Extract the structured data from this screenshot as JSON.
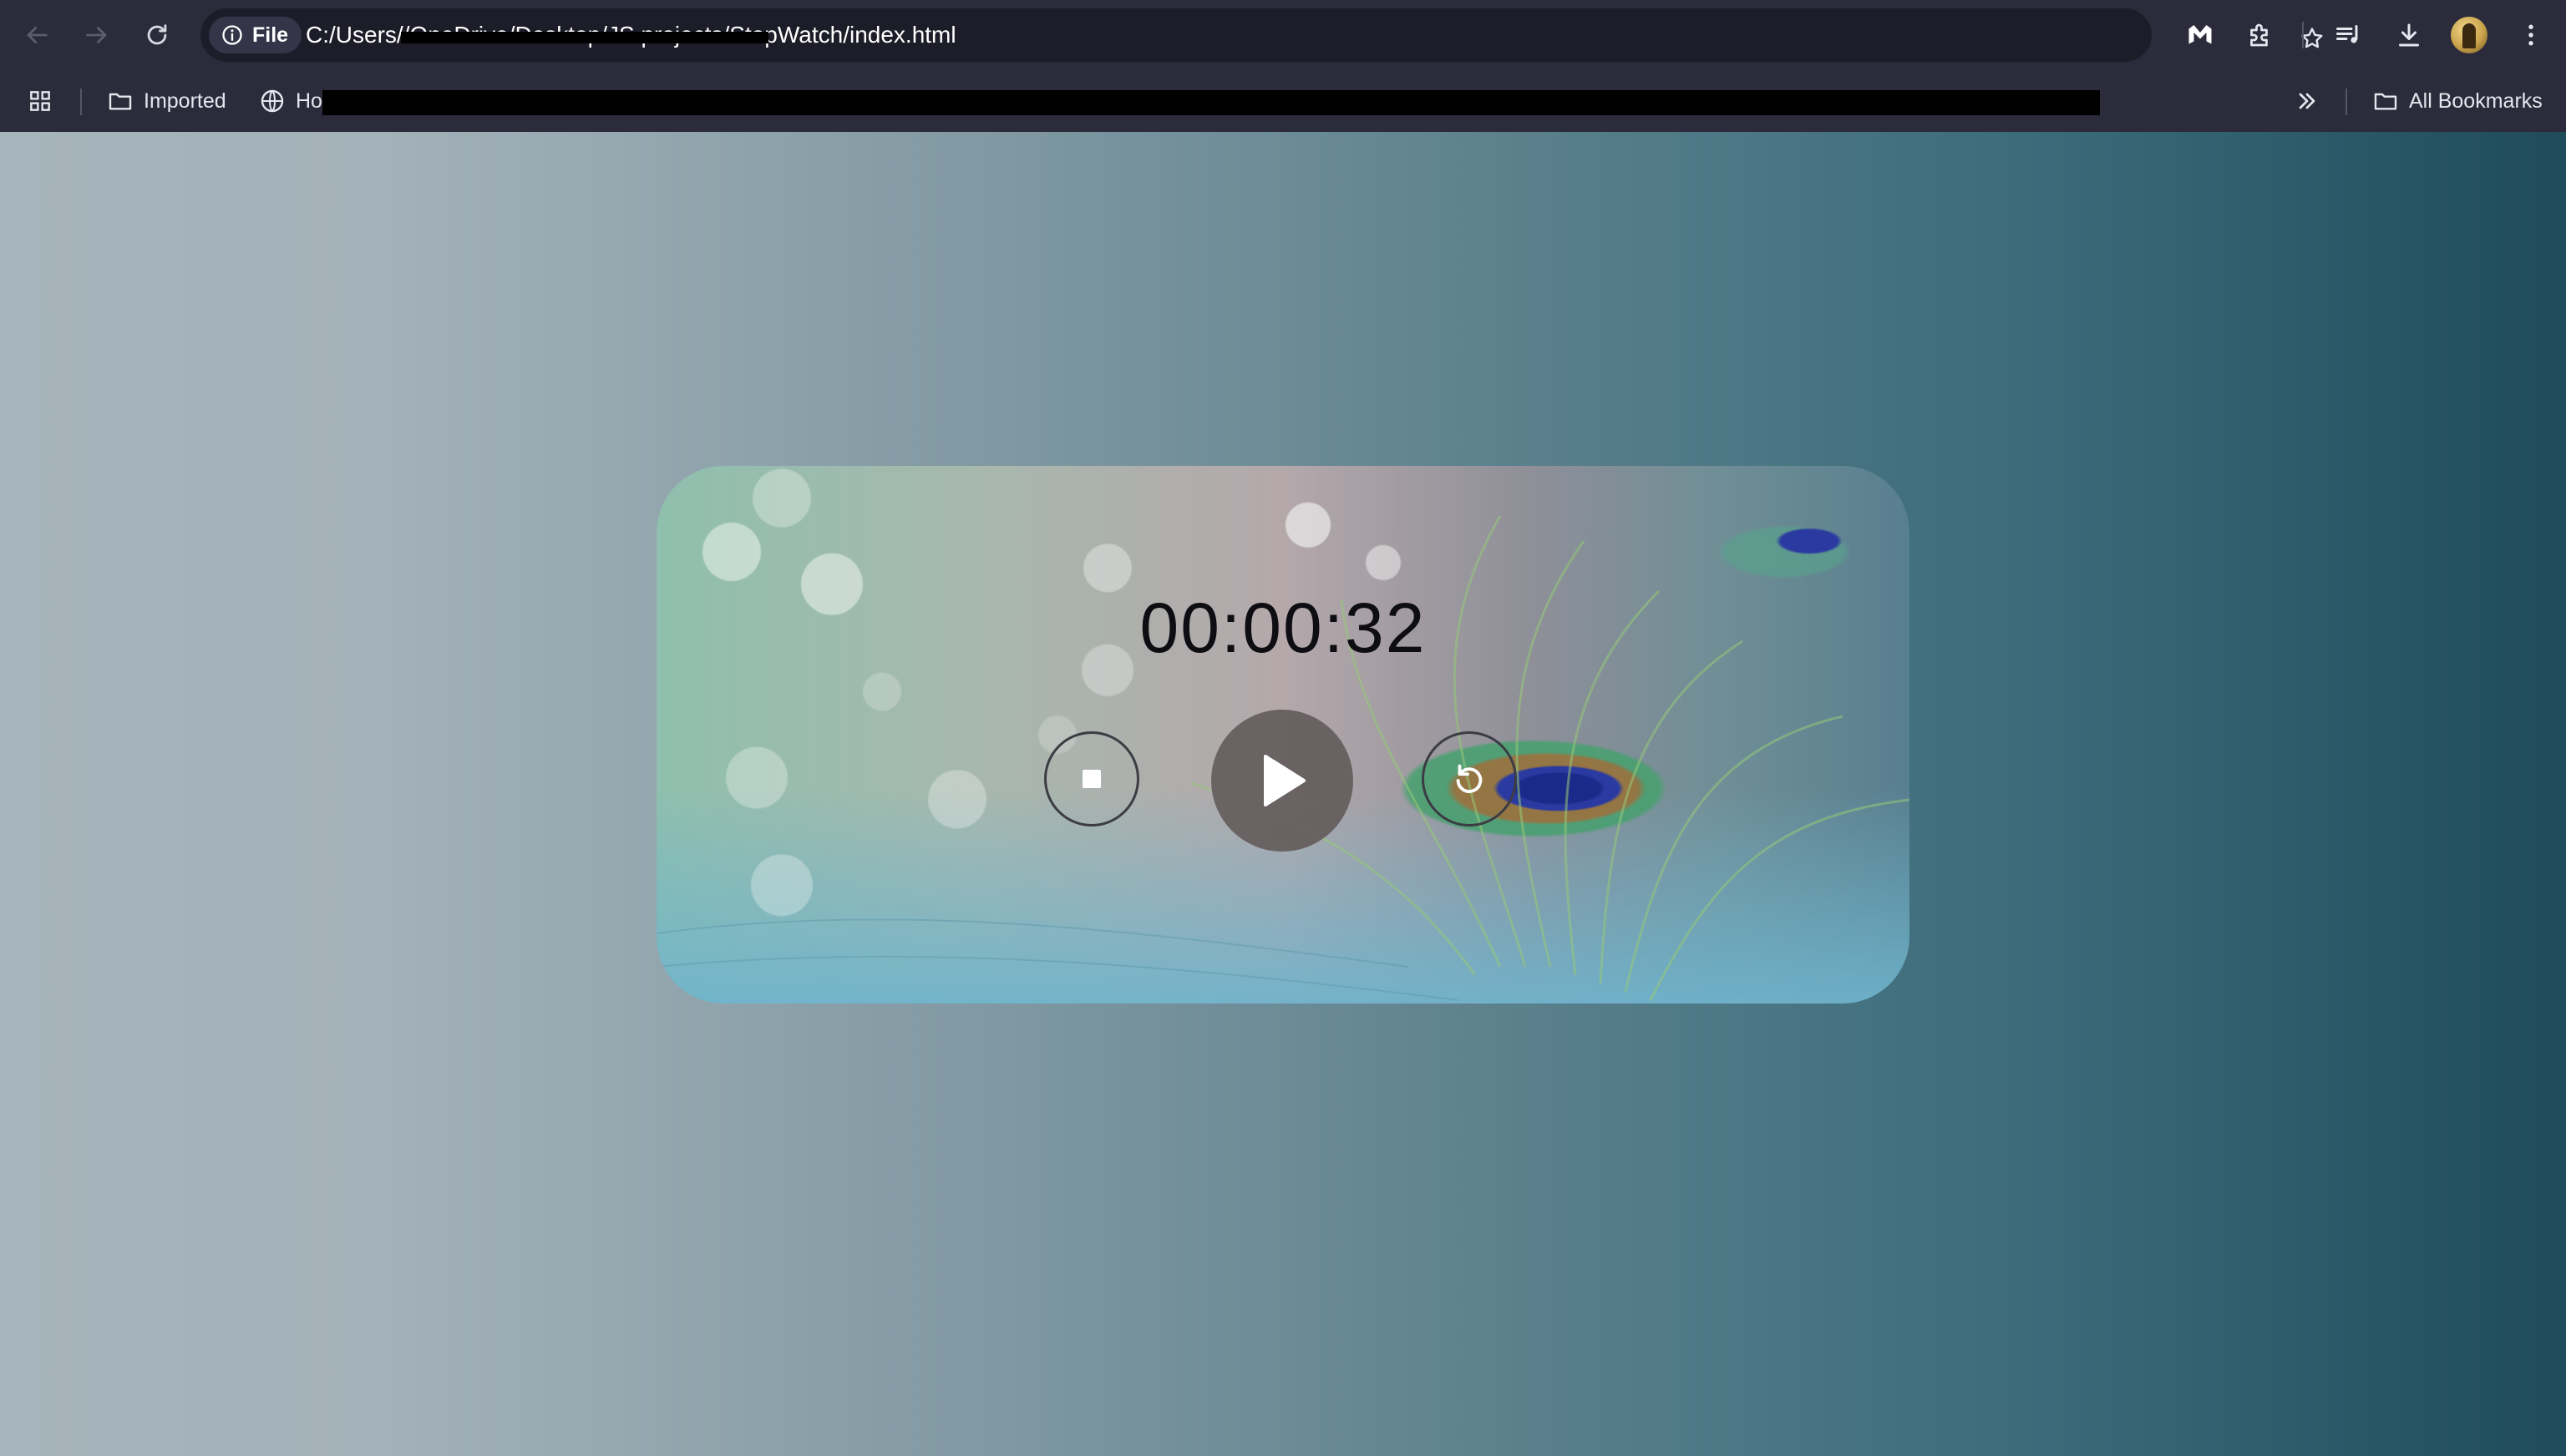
{
  "browser": {
    "site_chip_label": "File",
    "url_start": "C:/Users/",
    "url_mid": "/OneDrive/Desktop/JS projects",
    "url_end": "/StopWatch/index.html"
  },
  "bookmarks": {
    "imported_label": "Imported",
    "partial_label": "Ho",
    "all_bookmarks_label": "All Bookmarks"
  },
  "stopwatch": {
    "time_display": "00:00:32"
  },
  "colors": {
    "chrome_bg": "#2b2b3b",
    "omnibox_bg": "#1d1d29",
    "play_button_bg": "#645c5c"
  }
}
